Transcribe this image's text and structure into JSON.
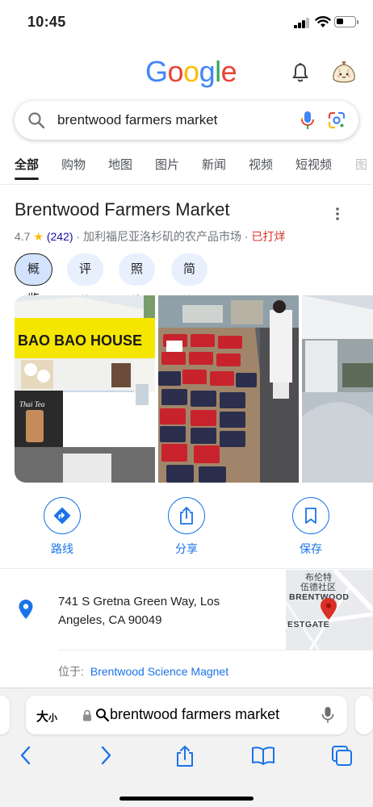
{
  "status_bar": {
    "time": "10:45"
  },
  "header": {
    "logo_letters": [
      "G",
      "o",
      "o",
      "g",
      "l",
      "e"
    ],
    "bell_icon": "notification-bell-icon",
    "avatar_icon": "dumpling-avatar-icon"
  },
  "search": {
    "query": "brentwood farmers market"
  },
  "tabs": [
    "全部",
    "购物",
    "地图",
    "图片",
    "新闻",
    "视频",
    "短视频",
    "图"
  ],
  "place": {
    "name": "Brentwood Farmers Market",
    "rating": "4.7",
    "star": "★",
    "review_count": "(242)",
    "description": "· 加利福尼亚洛杉矶的农产品市场 ·",
    "status": "已打烊"
  },
  "chips": [
    "概览",
    "评价",
    "照片",
    "简介"
  ],
  "photos": {
    "sign_text": "BAO BAO HOUSE",
    "poster_text": "Thai Tea"
  },
  "actions": {
    "directions": "路线",
    "share": "分享",
    "save": "保存"
  },
  "address": {
    "line1": "741 S Gretna Green Way, Los",
    "line2": "Angeles, CA 90049",
    "map_label_cn_1": "布伦特",
    "map_label_cn_2": "伍德社区",
    "map_label_en": "BRENTWOOD",
    "map_label_street": "ESTGATE",
    "located_label": "位于:",
    "located_value": "Brentwood Science Magnet"
  },
  "browser": {
    "aa": "大",
    "aa_small": "小",
    "url": "brentwood farmers market"
  },
  "colors": {
    "accent": "#1a73e8",
    "closed": "#d93025",
    "star": "#fbbc04",
    "map_pin": "#d93025"
  }
}
